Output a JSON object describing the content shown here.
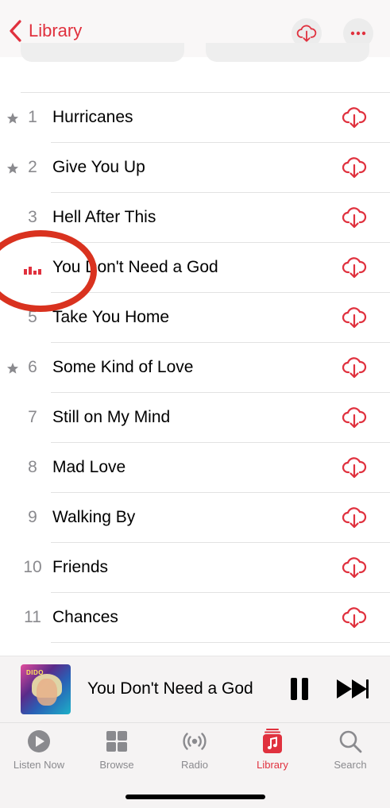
{
  "nav": {
    "back_label": "Library"
  },
  "tracks": [
    {
      "num": "1",
      "title": "Hurricanes",
      "favorite": true
    },
    {
      "num": "2",
      "title": "Give You Up",
      "favorite": true
    },
    {
      "num": "3",
      "title": "Hell After This",
      "favorite": false
    },
    {
      "num": "",
      "title": "You Don't Need a God",
      "favorite": false,
      "playing": true
    },
    {
      "num": "5",
      "title": "Take You Home",
      "favorite": false
    },
    {
      "num": "6",
      "title": "Some Kind of Love",
      "favorite": true
    },
    {
      "num": "7",
      "title": "Still on My Mind",
      "favorite": false
    },
    {
      "num": "8",
      "title": "Mad Love",
      "favorite": false
    },
    {
      "num": "9",
      "title": "Walking By",
      "favorite": false
    },
    {
      "num": "10",
      "title": "Friends",
      "favorite": false
    },
    {
      "num": "11",
      "title": "Chances",
      "favorite": false
    }
  ],
  "now_playing": {
    "title": "You Don't Need a God",
    "artwork_text": "DIDO"
  },
  "tabs": [
    {
      "label": "Listen Now",
      "icon": "play-circle-icon"
    },
    {
      "label": "Browse",
      "icon": "grid-icon"
    },
    {
      "label": "Radio",
      "icon": "radio-waves-icon"
    },
    {
      "label": "Library",
      "icon": "music-library-icon",
      "active": true
    },
    {
      "label": "Search",
      "icon": "search-icon"
    }
  ],
  "colors": {
    "accent": "#e0313e",
    "secondary_text": "#8a8a8e",
    "annotation": "#d9321f"
  }
}
